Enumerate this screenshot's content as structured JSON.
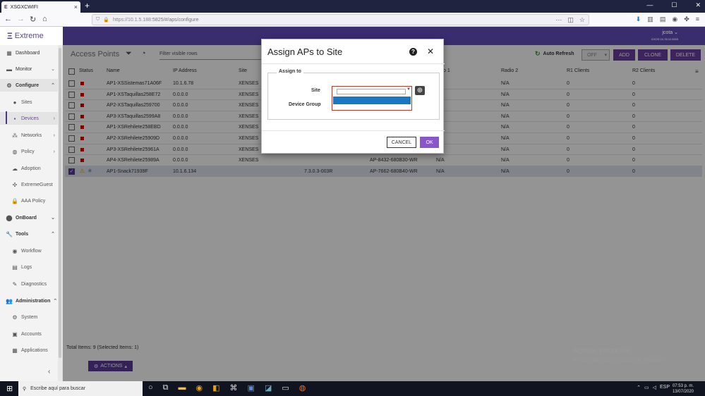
{
  "browser": {
    "tab_title": "XSGXCWIFI",
    "tab_close": "×",
    "new_tab": "+",
    "url_host": "https://10.1.5.188",
    "url_path": ":5825/#/aps/configure",
    "url_more": "···"
  },
  "app": {
    "logo": "Extreme",
    "user": "jcota",
    "version": "EXOS 04.78.02.0005"
  },
  "sidebar": {
    "items": [
      {
        "label": "Dashboard",
        "icon": "dashboard-icon"
      },
      {
        "label": "Monitor",
        "icon": "monitor-icon"
      },
      {
        "label": "Configure",
        "icon": "gear-icon"
      },
      {
        "label": "Sites",
        "icon": "pin-icon"
      },
      {
        "label": "Devices",
        "icon": "devices-icon"
      },
      {
        "label": "Networks",
        "icon": "network-icon"
      },
      {
        "label": "Policy",
        "icon": "policy-icon"
      },
      {
        "label": "Adoption",
        "icon": "cloud-icon"
      },
      {
        "label": "ExtremeGuest",
        "icon": "guest-icon"
      },
      {
        "label": "AAA Policy",
        "icon": "lock-icon"
      },
      {
        "label": "OnBoard",
        "icon": "onboard-icon"
      },
      {
        "label": "Tools",
        "icon": "wrench-icon"
      },
      {
        "label": "Workflow",
        "icon": "workflow-icon"
      },
      {
        "label": "Logs",
        "icon": "logs-icon"
      },
      {
        "label": "Diagnostics",
        "icon": "diagnostics-icon"
      },
      {
        "label": "Administration",
        "icon": "admin-icon"
      },
      {
        "label": "System",
        "icon": "system-icon"
      },
      {
        "label": "Accounts",
        "icon": "accounts-icon"
      },
      {
        "label": "Applications",
        "icon": "apps-icon"
      }
    ]
  },
  "toolbar": {
    "title": "Access Points",
    "filter_placeholder": "Filter visible rows",
    "auto_refresh": "Auto Refresh",
    "off": "OFF",
    "add": "ADD",
    "clone": "CLONE",
    "delete": "DELETE"
  },
  "table": {
    "columns": [
      "Status",
      "Name",
      "IP Address",
      "Site",
      "o 1",
      "Radio 2",
      "R1 Clients",
      "R2 Clients"
    ],
    "rows": [
      {
        "name": "AP1-XSSistemas71A06F",
        "ip": "10.1.6.78",
        "site": "XENSES",
        "v1": "",
        "v2": "",
        "radio1": "",
        "radio2": "N/A",
        "r1": "0",
        "r2": "0"
      },
      {
        "name": "AP1-XSTaquillas258E72",
        "ip": "0.0.0.0",
        "site": "XENSES",
        "v1": "",
        "v2": "",
        "radio1": "",
        "radio2": "N/A",
        "r1": "0",
        "r2": "0"
      },
      {
        "name": "AP2-XSTaquillas259700",
        "ip": "0.0.0.0",
        "site": "XENSES",
        "v1": "",
        "v2": "",
        "radio1": "",
        "radio2": "N/A",
        "r1": "0",
        "r2": "0"
      },
      {
        "name": "AP3-XSTaquillas2599A8",
        "ip": "0.0.0.0",
        "site": "XENSES",
        "v1": "",
        "v2": "",
        "radio1": "",
        "radio2": "N/A",
        "r1": "0",
        "r2": "0"
      },
      {
        "name": "AP1-XSRehilete258EBD",
        "ip": "0.0.0.0",
        "site": "XENSES",
        "v1": "",
        "v2": "",
        "radio1": "",
        "radio2": "N/A",
        "r1": "0",
        "r2": "0"
      },
      {
        "name": "AP2-XSRehilete25909D",
        "ip": "0.0.0.0",
        "site": "XENSES",
        "v1": "",
        "v2": "",
        "radio1": "",
        "radio2": "N/A",
        "r1": "0",
        "r2": "0"
      },
      {
        "name": "AP3-XSRehilete25961A",
        "ip": "0.0.0.0",
        "site": "XENSES",
        "v1": "",
        "v2": "",
        "radio1": "",
        "radio2": "N/A",
        "r1": "0",
        "r2": "0"
      },
      {
        "name": "AP4-XSRehilete25989A",
        "ip": "0.0.0.0",
        "site": "XENSES",
        "v1": "",
        "v2": "AP-8432-680B30-WR",
        "radio1": "N/A",
        "radio2": "N/A",
        "r1": "0",
        "r2": "0"
      },
      {
        "name": "AP1-Snack71939F",
        "ip": "10.1.6.134",
        "site": "",
        "v1": "7.3.0.3-003R",
        "v2": "AP-7662-680B40-WR",
        "radio1": "N/A",
        "radio2": "N/A",
        "r1": "0",
        "r2": "0"
      }
    ],
    "total": "Total Items: 9 (Selected Items: 1)",
    "actions": "ACTIONS"
  },
  "modal": {
    "title": "Assign APs to Site",
    "help": "?",
    "close": "✕",
    "legend": "Assign to",
    "site_label": "Site",
    "device_group_label": "Device Group",
    "cancel": "CANCEL",
    "ok": "OK"
  },
  "watermark": {
    "line1": "Activar Windows",
    "line2": "Ve a Configuración para activar Windows."
  },
  "taskbar": {
    "search": "Escribe aquí para buscar",
    "lang": "ESP",
    "time": "07:53 p. m.",
    "date": "13/07/2020"
  },
  "colors": {
    "accent": "#6b3fa0",
    "header": "#3a2d6e",
    "status_red": "#cc0000",
    "selection_blue": "#1a78c2"
  }
}
